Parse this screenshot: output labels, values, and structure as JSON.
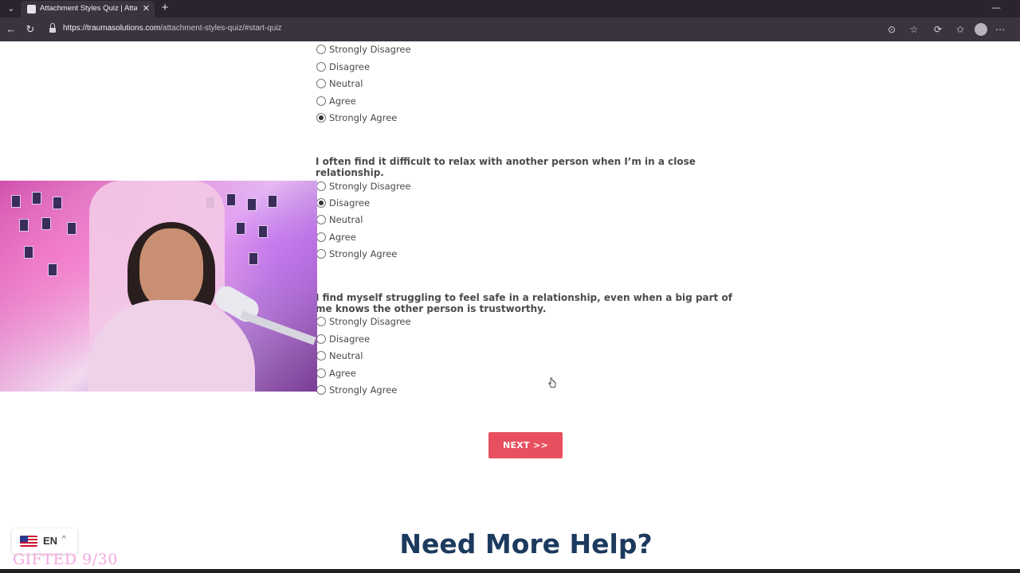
{
  "browser": {
    "tab_title": "Attachment Styles Quiz | Attachm",
    "url_host": "https://traumasolutions.com",
    "url_path": "/attachment-styles-quiz/#start-quiz"
  },
  "quiz": {
    "partial_question_tail": "",
    "question_1": {
      "text": "",
      "options": [
        "Strongly Disagree",
        "Disagree",
        "Neutral",
        "Agree",
        "Strongly Agree"
      ],
      "selected": "Strongly Agree"
    },
    "question_2": {
      "text": "I often find it difficult to relax with another person when I’m in a close relationship.",
      "options": [
        "Strongly Disagree",
        "Disagree",
        "Neutral",
        "Agree",
        "Strongly Agree"
      ],
      "selected": "Disagree"
    },
    "question_3": {
      "text": "I find myself struggling to feel safe in a relationship, even when a big part of me knows the other person is trustworthy.",
      "options": [
        "Strongly Disagree",
        "Disagree",
        "Neutral",
        "Agree",
        "Strongly Agree"
      ],
      "selected": ""
    },
    "next_label": "NEXT >>"
  },
  "help_heading": "Need More Help?",
  "language": {
    "code": "EN"
  },
  "overlay_text": "GIFTED 9/30",
  "colors": {
    "accent": "#e8505f",
    "heading": "#1c3a5e"
  }
}
